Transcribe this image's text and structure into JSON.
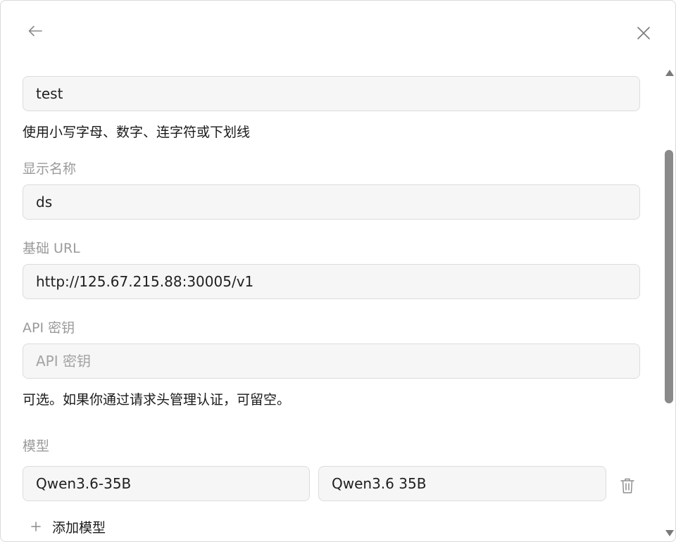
{
  "header": {
    "back_icon": "arrow-left-icon",
    "close_icon": "close-icon"
  },
  "form": {
    "id_field": {
      "value": "test",
      "hint": "使用小写字母、数字、连字符或下划线"
    },
    "display_name": {
      "label": "显示名称",
      "value": "ds"
    },
    "base_url": {
      "label": "基础 URL",
      "value": "http://125.67.215.88:30005/v1"
    },
    "api_key": {
      "label": "API 密钥",
      "placeholder": "API 密钥",
      "value": "",
      "hint": "可选。如果你通过请求头管理认证，可留空。"
    },
    "models": {
      "label": "模型",
      "items": [
        {
          "id": "Qwen3.6-35B",
          "name": "Qwen3.6 35B"
        }
      ],
      "add_label": "添加模型",
      "delete_icon": "trash-icon",
      "add_icon": "plus-icon"
    }
  }
}
